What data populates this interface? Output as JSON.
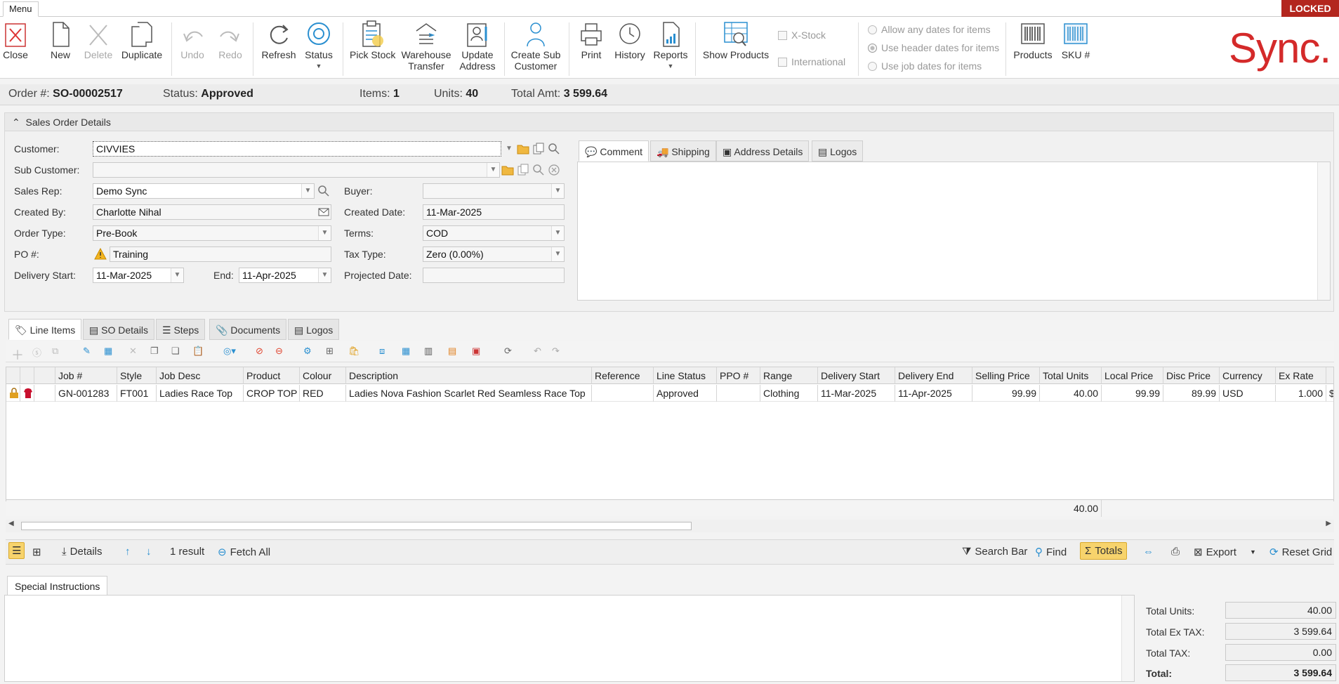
{
  "menu": {
    "label": "Menu",
    "locked": "LOCKED"
  },
  "ribbon": {
    "close": "Close",
    "new": "New",
    "delete": "Delete",
    "duplicate": "Duplicate",
    "undo": "Undo",
    "redo": "Redo",
    "refresh": "Refresh",
    "status": "Status",
    "pick_stock": "Pick Stock",
    "warehouse_1": "Warehouse",
    "warehouse_2": "Transfer",
    "update_1": "Update",
    "update_2": "Address",
    "create_1": "Create Sub",
    "create_2": "Customer",
    "print": "Print",
    "history": "History",
    "reports": "Reports",
    "show_products": "Show Products",
    "x_stock": "X-Stock",
    "international": "International",
    "opt_any": "Allow any dates for items",
    "opt_header": "Use header dates for items",
    "opt_job": "Use job dates for items",
    "products": "Products",
    "sku": "SKU #",
    "brand": "Sync."
  },
  "summary": {
    "order_lbl": "Order #:",
    "order_val": "SO-00002517",
    "status_lbl": "Status:",
    "status_val": "Approved",
    "items_lbl": "Items:",
    "items_val": "1",
    "units_lbl": "Units:",
    "units_val": "40",
    "total_lbl": "Total Amt:",
    "total_val": "3 599.64"
  },
  "details": {
    "title": "Sales Order Details",
    "customer_lbl": "Customer:",
    "customer": "CIVVIES",
    "subcustomer_lbl": "Sub Customer:",
    "subcustomer": "",
    "salesrep_lbl": "Sales Rep:",
    "salesrep": "Demo Sync",
    "buyer_lbl": "Buyer:",
    "buyer": "",
    "createdby_lbl": "Created By:",
    "createdby": "Charlotte Nihal",
    "createddate_lbl": "Created Date:",
    "createddate": "11-Mar-2025",
    "ordertype_lbl": "Order Type:",
    "ordertype": "Pre-Book",
    "terms_lbl": "Terms:",
    "terms": "COD",
    "po_lbl": "PO #:",
    "po": "Training",
    "taxtype_lbl": "Tax Type:",
    "taxtype": "Zero (0.00%)",
    "delstart_lbl": "Delivery Start:",
    "delstart": "11-Mar-2025",
    "end_lbl": "End:",
    "end": "11-Apr-2025",
    "projected_lbl": "Projected Date:",
    "projected": ""
  },
  "comment_tabs": [
    "Comment",
    "Shipping",
    "Address Details",
    "Logos"
  ],
  "bottom_tabs": [
    "Line Items",
    "SO Details",
    "Steps",
    "Documents",
    "Logos"
  ],
  "grid": {
    "columns": [
      "Job #",
      "Style",
      "Job Desc",
      "Product",
      "Colour",
      "Description",
      "Reference",
      "Line Status",
      "PPO #",
      "Range",
      "Delivery Start",
      "Delivery End",
      "Selling Price",
      "Total Units",
      "Local Price",
      "Disc Price",
      "Currency",
      "Ex Rate"
    ],
    "row": [
      "GN-001283",
      "FT001",
      "Ladies Race Top",
      "CROP TOP",
      "RED",
      "Ladies Nova Fashion Scarlet Red Seamless Race Top",
      "",
      "Approved",
      "",
      "Clothing",
      "11-Mar-2025",
      "11-Apr-2025",
      "99.99",
      "40.00",
      "99.99",
      "89.99",
      "USD",
      "1.000"
    ],
    "row_trailing": "$",
    "footer_total_units": "40.00"
  },
  "statusbar": {
    "details": "Details",
    "result": "1 result",
    "fetch_all": "Fetch All",
    "search_bar": "Search Bar",
    "find": "Find",
    "totals": "Totals",
    "export": "Export",
    "reset_grid": "Reset Grid"
  },
  "special": {
    "tab": "Special Instructions"
  },
  "totals": {
    "units_lbl": "Total Units:",
    "units": "40.00",
    "extax_lbl": "Total Ex TAX:",
    "extax": "3 599.64",
    "tax_lbl": "Total TAX:",
    "tax": "0.00",
    "total_lbl": "Total:",
    "total": "3 599.64"
  },
  "colors": {
    "accent": "#2a8fd0",
    "brand": "#d42a2a",
    "locked": "#b3261e",
    "highlight": "#f7d36c"
  }
}
